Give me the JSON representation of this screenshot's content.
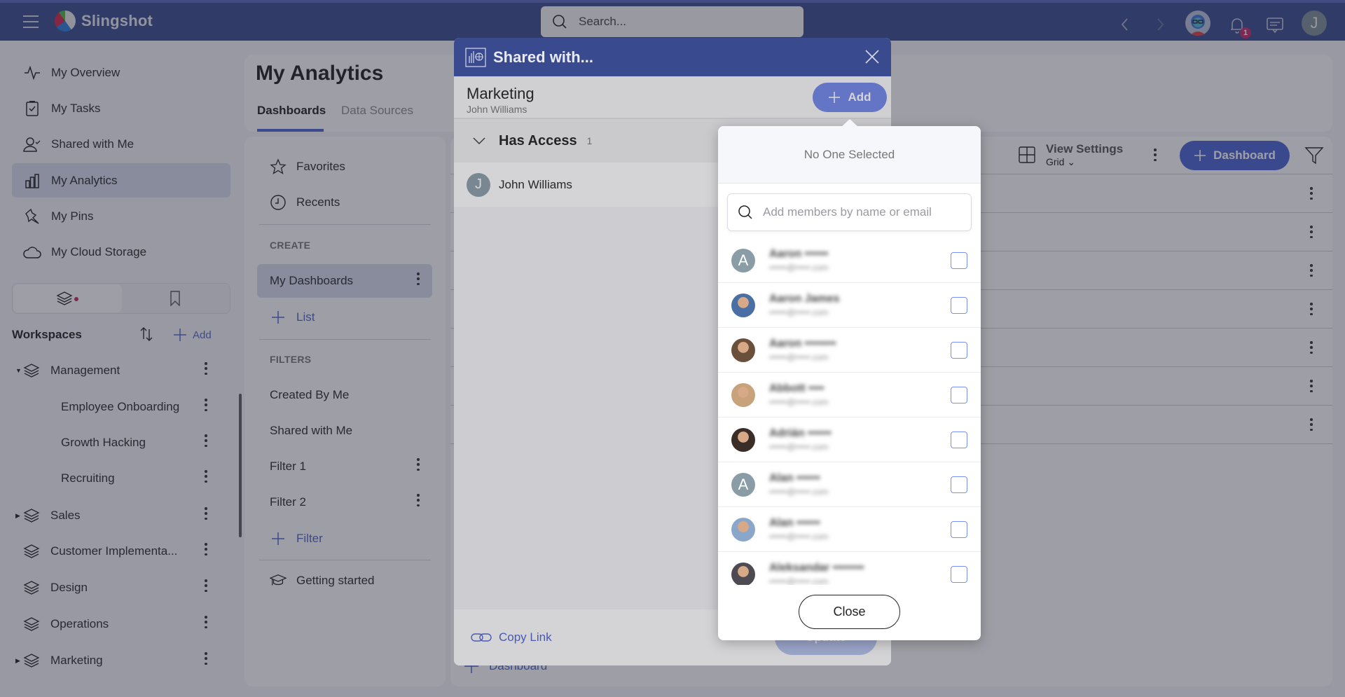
{
  "app": {
    "brand": "Slingshot",
    "search_placeholder": "Search...",
    "notification_count": "1",
    "user_initial": "J"
  },
  "sidebar": {
    "items": [
      {
        "label": "My Overview",
        "icon": "activity-icon"
      },
      {
        "label": "My Tasks",
        "icon": "clipboard-check-icon"
      },
      {
        "label": "Shared with Me",
        "icon": "user-check-icon"
      },
      {
        "label": "My Analytics",
        "icon": "bar-chart-icon",
        "active": true
      },
      {
        "label": "My Pins",
        "icon": "pin-icon"
      },
      {
        "label": "My Cloud Storage",
        "icon": "cloud-icon"
      }
    ],
    "workspaces_title": "Workspaces",
    "add_label": "Add",
    "workspaces": [
      {
        "label": "Management",
        "expanded": true,
        "children": [
          "Employee Onboarding",
          "Growth Hacking",
          "Recruiting"
        ]
      },
      {
        "label": "Sales",
        "expanded": false
      },
      {
        "label": "Customer Implementa...",
        "expanded": null
      },
      {
        "label": "Design",
        "expanded": null
      },
      {
        "label": "Operations",
        "expanded": null
      },
      {
        "label": "Marketing",
        "expanded": false
      }
    ]
  },
  "page": {
    "title": "My Analytics",
    "tabs": [
      {
        "label": "Dashboards",
        "active": true
      },
      {
        "label": "Data Sources",
        "active": false
      }
    ]
  },
  "nav": {
    "favorites": "Favorites",
    "recents": "Recents",
    "create_label": "CREATE",
    "my_dashboards": "My Dashboards",
    "add_list": "List",
    "filters_label": "FILTERS",
    "filters": [
      "Created By Me",
      "Shared with Me",
      "Filter 1",
      "Filter 2"
    ],
    "add_filter": "Filter",
    "getting_started": "Getting started"
  },
  "toolbar": {
    "view_settings": "View Settings",
    "view_mode": "Grid",
    "add_dashboard": "Dashboard"
  },
  "list": {
    "row_count": 7,
    "add_dashboard": "Dashboard"
  },
  "modal": {
    "title": "Shared with...",
    "workspace_name": "Marketing",
    "owner": "John Williams",
    "add_button": "Add",
    "has_access_label": "Has Access",
    "has_access_count": "1",
    "members": [
      {
        "initial": "J",
        "name": "John Williams"
      }
    ],
    "copy_link": "Copy Link",
    "update_button": "Update"
  },
  "popover": {
    "status": "No One Selected",
    "search_placeholder": "Add members by name or email",
    "candidates": [
      {
        "avatar": "initial",
        "initial": "A",
        "name": "Aaron ••••••",
        "email": "••••••@•••••.com",
        "checked": false
      },
      {
        "avatar": "photo",
        "name": "Aaron James",
        "email": "••••••@•••••.com",
        "checked": false
      },
      {
        "avatar": "photo",
        "name": "Aaron ••••••••",
        "email": "••••••@•••••.com",
        "checked": false
      },
      {
        "avatar": "photo",
        "name": "Abbott ••••",
        "email": "••••••@•••••.com",
        "checked": false
      },
      {
        "avatar": "photo",
        "name": "Adrián ••••••",
        "email": "••••••@•••••.com",
        "checked": false
      },
      {
        "avatar": "initial",
        "initial": "A",
        "name": "Alan ••••••",
        "email": "••••••@•••••.com",
        "checked": false
      },
      {
        "avatar": "photo",
        "name": "Alan ••••••",
        "email": "••••••@•••••.com",
        "checked": false
      },
      {
        "avatar": "photo",
        "name": "Aleksandar ••••••••",
        "email": "••••••@•••••.com",
        "checked": false
      }
    ],
    "close_button": "Close"
  }
}
